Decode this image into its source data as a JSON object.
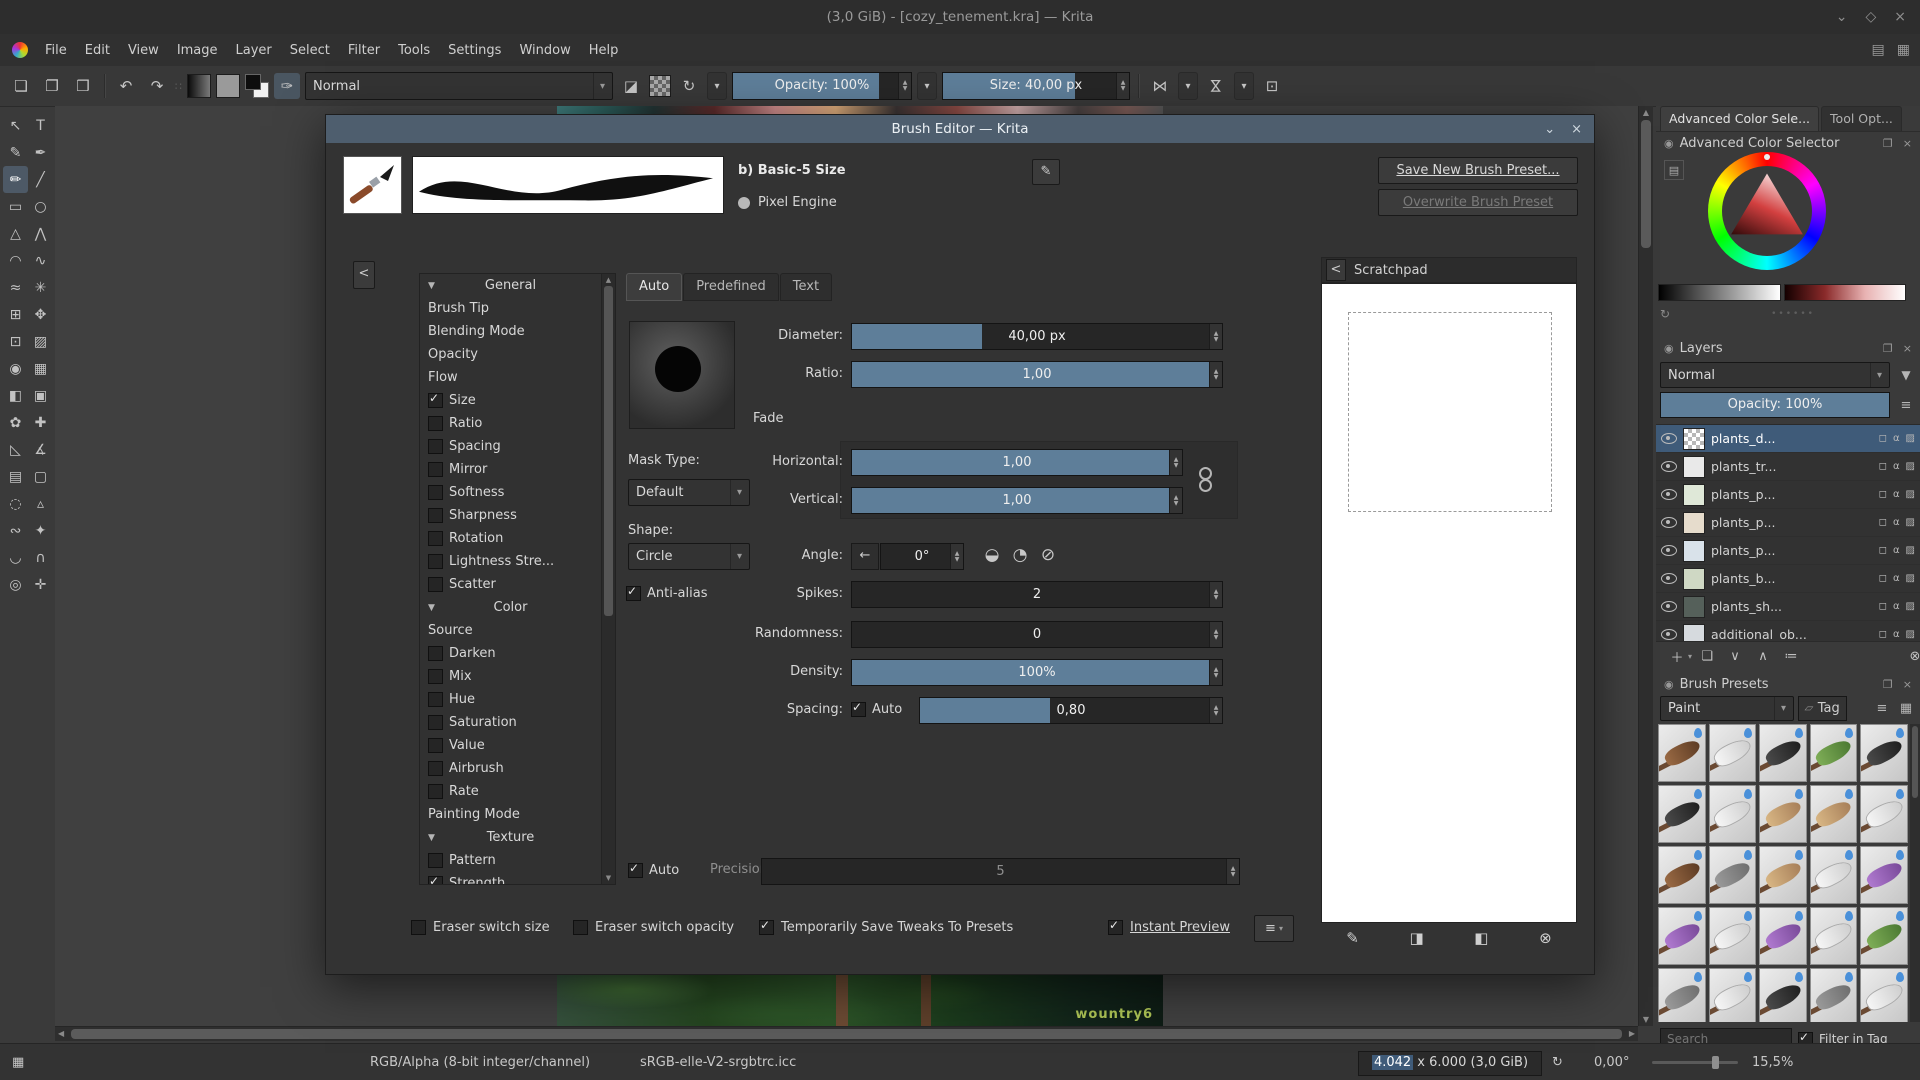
{
  "colors": {
    "accent_blue": "#5e7e99",
    "selection_blue": "#3f5b79",
    "dialog_titlebar": "#4e5e6e",
    "droplet_blue": "#4a90d9",
    "canvas_background": "#404040"
  },
  "icons": {
    "minimize": "⌄",
    "maximize": "◇",
    "close": "×",
    "new-document": "❏",
    "open": "❐",
    "save": "❒",
    "undo": "↶",
    "redo": "↷",
    "grip": "∷",
    "choose-brush": "✑",
    "eraser": "◪",
    "reload": "↻",
    "caret-down": "▾",
    "mirror": "⋈",
    "wrap-around": "⊡",
    "workspace-a": "▤",
    "workspace-b": "▦",
    "edit": "✎",
    "docker": "◉",
    "float": "❐",
    "funnel": "▼",
    "hamburger": "≡",
    "refresh": "↻",
    "collapse-left": "<",
    "chevron-down": "⌄",
    "plus": "＋",
    "duplicate": "❏",
    "arrow-down": "∨",
    "arrow-up": "∧",
    "properties": "≔",
    "delete": "⊗",
    "tag": "▱",
    "grid-view": "▦",
    "angle-arrow": "←",
    "gauge-half": "◒",
    "gauge-quarter": "◔",
    "gauge-none": "⊘",
    "scratch-pencil": "✎",
    "scratch-fill-area": "◨",
    "scratch-fill": "◧",
    "scratch-clear": "⊗",
    "memory": "▦",
    "rotate-reset": "↻",
    "scroll-up": "▲",
    "scroll-down": "▼",
    "scroll-left": "◀",
    "scroll-right": "▶"
  },
  "window": {
    "title": "(3,0 GiB) - [cozy_tenement.kra] — Krita"
  },
  "menubar": [
    "File",
    "Edit",
    "View",
    "Image",
    "Layer",
    "Select",
    "Filter",
    "Tools",
    "Settings",
    "Window",
    "Help"
  ],
  "toolbar": {
    "blending_mode": "Normal",
    "opacity": "Opacity: 100%",
    "opacity_fill": 82,
    "size": "Size: 40,00 px",
    "size_fill": 71
  },
  "toolbox": [
    {
      "glyph": "↖",
      "name": "select-shapes-tool"
    },
    {
      "glyph": "T",
      "name": "text-tool"
    },
    {
      "glyph": "✎",
      "name": "edit-shapes-tool"
    },
    {
      "glyph": "✒",
      "name": "calligraphy-tool"
    },
    {
      "glyph": "✏",
      "name": "freehand-brush-tool",
      "active": true
    },
    {
      "glyph": "╱",
      "name": "line-tool"
    },
    {
      "glyph": "▭",
      "name": "rectangle-tool"
    },
    {
      "glyph": "○",
      "name": "ellipse-tool"
    },
    {
      "glyph": "△",
      "name": "polygon-tool"
    },
    {
      "glyph": "⋀",
      "name": "polyline-tool"
    },
    {
      "glyph": "◠",
      "name": "bezier-curve-tool"
    },
    {
      "glyph": "∿",
      "name": "freehand-path-tool"
    },
    {
      "glyph": "≈",
      "name": "dynamic-brush-tool"
    },
    {
      "glyph": "✳",
      "name": "multibrush-tool"
    },
    {
      "glyph": "⊞",
      "name": "transform-tool"
    },
    {
      "glyph": "✥",
      "name": "move-tool"
    },
    {
      "glyph": "⊡",
      "name": "crop-tool"
    },
    {
      "glyph": "▨",
      "name": "gradient-tool"
    },
    {
      "glyph": "◉",
      "name": "color-sampler-tool"
    },
    {
      "glyph": "▦",
      "name": "pattern-editing-tool"
    },
    {
      "glyph": "◧",
      "name": "fill-tool"
    },
    {
      "glyph": "▣",
      "name": "enclose-and-fill-tool"
    },
    {
      "glyph": "✿",
      "name": "colorize-mask-tool"
    },
    {
      "glyph": "✚",
      "name": "smart-patch-tool"
    },
    {
      "glyph": "◺",
      "name": "assistants-tool"
    },
    {
      "glyph": "∡",
      "name": "measure-tool"
    },
    {
      "glyph": "▤",
      "name": "reference-images-tool"
    },
    {
      "glyph": "▢",
      "name": "rectangular-selection-tool"
    },
    {
      "glyph": "◌",
      "name": "elliptical-selection-tool"
    },
    {
      "glyph": "▵",
      "name": "polygonal-selection-tool"
    },
    {
      "glyph": "∾",
      "name": "freehand-selection-tool"
    },
    {
      "glyph": "✦",
      "name": "contiguous-selection-tool"
    },
    {
      "glyph": "◡",
      "name": "bezier-selection-tool"
    },
    {
      "glyph": "∩",
      "name": "magnetic-selection-tool"
    },
    {
      "glyph": "◎",
      "name": "zoom-tool"
    },
    {
      "glyph": "✛",
      "name": "pan-tool"
    }
  ],
  "canvas": {
    "signature": "wountry6"
  },
  "dialog": {
    "title": "Brush Editor — Krita",
    "preset_name": "b) Basic-5 Size",
    "engine": "Pixel Engine",
    "save_button": "Save New Brush Preset...",
    "overwrite_button": "Overwrite Brush Preset",
    "scratchpad_title": "Scratchpad",
    "tabs": [
      "Auto",
      "Predefined",
      "Text"
    ],
    "options": [
      {
        "type": "header",
        "label": "General"
      },
      {
        "type": "item",
        "label": "Brush Tip"
      },
      {
        "type": "item",
        "label": "Blending Mode"
      },
      {
        "type": "item",
        "label": "Opacity"
      },
      {
        "type": "item",
        "label": "Flow"
      },
      {
        "type": "check",
        "label": "Size",
        "checked": true
      },
      {
        "type": "check",
        "label": "Ratio",
        "checked": false
      },
      {
        "type": "check",
        "label": "Spacing",
        "checked": false
      },
      {
        "type": "check",
        "label": "Mirror",
        "checked": false
      },
      {
        "type": "check",
        "label": "Softness",
        "checked": false
      },
      {
        "type": "check",
        "label": "Sharpness",
        "checked": false
      },
      {
        "type": "check",
        "label": "Rotation",
        "checked": false
      },
      {
        "type": "check",
        "label": "Lightness Stre...",
        "checked": false
      },
      {
        "type": "check",
        "label": "Scatter",
        "checked": false
      },
      {
        "type": "header",
        "label": "Color"
      },
      {
        "type": "item",
        "label": "Source"
      },
      {
        "type": "check",
        "label": "Darken",
        "checked": false
      },
      {
        "type": "check",
        "label": "Mix",
        "checked": false
      },
      {
        "type": "check",
        "label": "Hue",
        "checked": false
      },
      {
        "type": "check",
        "label": "Saturation",
        "checked": false
      },
      {
        "type": "check",
        "label": "Value",
        "checked": false
      },
      {
        "type": "check",
        "label": "Airbrush",
        "checked": false
      },
      {
        "type": "check",
        "label": "Rate",
        "checked": false
      },
      {
        "type": "item",
        "label": "Painting Mode"
      },
      {
        "type": "header",
        "label": "Texture"
      },
      {
        "type": "check",
        "label": "Pattern",
        "checked": false
      },
      {
        "type": "check",
        "label": "Strength",
        "checked": true
      }
    ],
    "fields": {
      "diameter": {
        "label": "Diameter:",
        "value": "40,00 px",
        "fill": 35
      },
      "ratio": {
        "label": "Ratio:",
        "value": "1,00",
        "fill": 99
      },
      "fade": "Fade",
      "mask_type_label": "Mask Type:",
      "mask_type": "Default",
      "horizontal": {
        "label": "Horizontal:",
        "value": "1,00",
        "fill": 100
      },
      "vertical": {
        "label": "Vertical:",
        "value": "1,00",
        "fill": 100
      },
      "shape_label": "Shape:",
      "shape": "Circle",
      "angle_label": "Angle:",
      "angle_value": "0°",
      "antialias_label": "Anti-alias",
      "spikes": {
        "label": "Spikes:",
        "value": "2",
        "fill": 0
      },
      "randomness": {
        "label": "Randomness:",
        "value": "0",
        "fill": 0
      },
      "density": {
        "label": "Density:",
        "value": "100%",
        "fill": 100
      },
      "spacing": {
        "label": "Spacing:",
        "auto_label": "Auto",
        "value": "0,80",
        "fill": 43
      },
      "auto_label": "Auto",
      "precision_label": "Precision:",
      "precision_value": "5"
    },
    "footer": {
      "eraser_switch_size": "Eraser switch size",
      "eraser_switch_opacity": "Eraser switch opacity",
      "save_tweaks": "Temporarily Save Tweaks To Presets",
      "instant_preview": "Instant Preview"
    }
  },
  "right_panel": {
    "tabs": [
      "Advanced Color Sele...",
      "Tool Opt..."
    ],
    "advanced_color_selector": {
      "title": "Advanced Color Selector"
    },
    "layers": {
      "title": "Layers",
      "blending": "Normal",
      "opacity": "Opacity: 100%",
      "opacity_fill": 100,
      "items": [
        {
          "name": "plants_d...",
          "selected": true,
          "thumb": "checker"
        },
        {
          "name": "plants_tr...",
          "thumb": "#e9e9e9"
        },
        {
          "name": "plants_p...",
          "thumb": "#dfe8d8"
        },
        {
          "name": "plants_p...",
          "thumb": "#e6dccc"
        },
        {
          "name": "plants_p...",
          "thumb": "#d9e2ea"
        },
        {
          "name": "plants_b...",
          "thumb": "#cfd8c4"
        },
        {
          "name": "plants_sh...",
          "thumb": "#55605a"
        },
        {
          "name": "additional_ob...",
          "thumb": "#d6dade"
        }
      ]
    },
    "presets": {
      "title": "Brush Presets",
      "filter": "Paint",
      "tag_label": "Tag",
      "search_placeholder": "Search",
      "filter_in_tag": "Filter in Tag",
      "items": [
        {
          "tone": "brown"
        },
        {
          "tone": "white"
        },
        {
          "tone": "dark"
        },
        {
          "tone": "green"
        },
        {
          "tone": "dark"
        },
        {
          "tone": "dark"
        },
        {
          "tone": "white"
        },
        {
          "tone": "tan"
        },
        {
          "tone": "tan"
        },
        {
          "tone": "white"
        },
        {
          "tone": "brown"
        },
        {
          "tone": "gray"
        },
        {
          "tone": "tan"
        },
        {
          "tone": "white"
        },
        {
          "tone": "purple"
        },
        {
          "tone": "purple"
        },
        {
          "tone": "white"
        },
        {
          "tone": "purple"
        },
        {
          "tone": "white"
        },
        {
          "tone": "green"
        },
        {
          "tone": "gray"
        },
        {
          "tone": "white"
        },
        {
          "tone": "dark"
        },
        {
          "tone": "gray"
        },
        {
          "tone": "white"
        }
      ]
    }
  },
  "statusbar": {
    "color_mode": "RGB/Alpha (8-bit integer/channel)",
    "profile": "sRGB-elle-V2-srgbtrc.icc",
    "size_highlight": "4.042",
    "size_rest": " x 6.000 (3,0 GiB)",
    "rotation": "0,00°",
    "zoom": "15,5%"
  }
}
